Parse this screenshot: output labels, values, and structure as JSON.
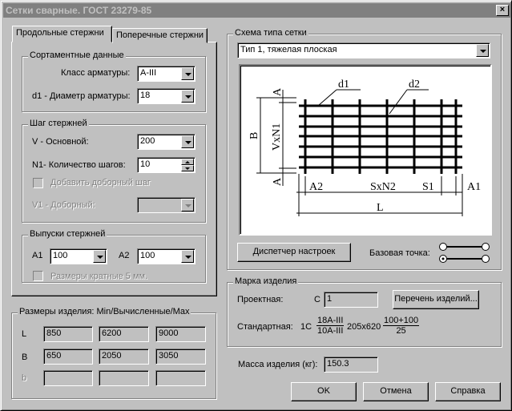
{
  "window": {
    "title": "Сетки сварные. ГОСТ 23279-85",
    "close": "×"
  },
  "tabs": [
    {
      "label": "Продольные стержни",
      "active": true
    },
    {
      "label": "Поперечные стержни",
      "active": false
    }
  ],
  "assortment": {
    "title": "Сортаментные данные",
    "class_label": "Класс арматуры:",
    "class_value": "A-III",
    "diameter_label": "d1 - Диаметр арматуры:",
    "diameter_value": "18"
  },
  "pitch": {
    "title": "Шаг стержней",
    "main_label": "V  - Основной:",
    "main_value": "200",
    "count_label": "N1- Количество шагов:",
    "count_value": "10",
    "add_extra_label": "Добавить доборный шаг",
    "extra_label": "V1 - Доборный:",
    "extra_value": ""
  },
  "outlets": {
    "title": "Выпуски стержней",
    "a1_label": "A1",
    "a1_value": "100",
    "a2_label": "A2",
    "a2_value": "100",
    "multiple5_label": "Размеры кратные 5 мм."
  },
  "sizes": {
    "title": "Размеры изделия: Min/Вычисленные/Max",
    "rows": [
      {
        "label": "L",
        "min": "850",
        "calc": "6200",
        "max": "9000"
      },
      {
        "label": "B",
        "min": "650",
        "calc": "2050",
        "max": "3050"
      },
      {
        "label": "b",
        "min": "",
        "calc": "",
        "max": ""
      }
    ]
  },
  "scheme": {
    "title": "Схема типа сетки",
    "type_value": "Тип 1, тяжелая плоская",
    "settings_button": "Диспетчер настроек",
    "base_point_label": "Базовая точка:",
    "diagram": {
      "d1": "d1",
      "d2": "d2",
      "B": "B",
      "VxN1": "VxN1",
      "A_top": "A",
      "A_bottom": "A",
      "A2": "A2",
      "SxN2": "SxN2",
      "S1": "S1",
      "A1": "A1",
      "L": "L"
    }
  },
  "mark": {
    "title": "Марка изделия",
    "project_label": "Проектная:",
    "project_prefix": "С",
    "project_value": "1",
    "list_button": "Перечень изделий...",
    "standard_label": "Стандартная:",
    "standard_prefix": "1С",
    "frac1_num": "18A-III",
    "frac1_den": "10A-III",
    "dims": "205x620",
    "frac2_num": "100+100",
    "frac2_den": "25"
  },
  "mass": {
    "label": "Масса изделия (кг):",
    "value": "150.3"
  },
  "buttons": {
    "ok": "OK",
    "cancel": "Отмена",
    "help": "Справка"
  }
}
